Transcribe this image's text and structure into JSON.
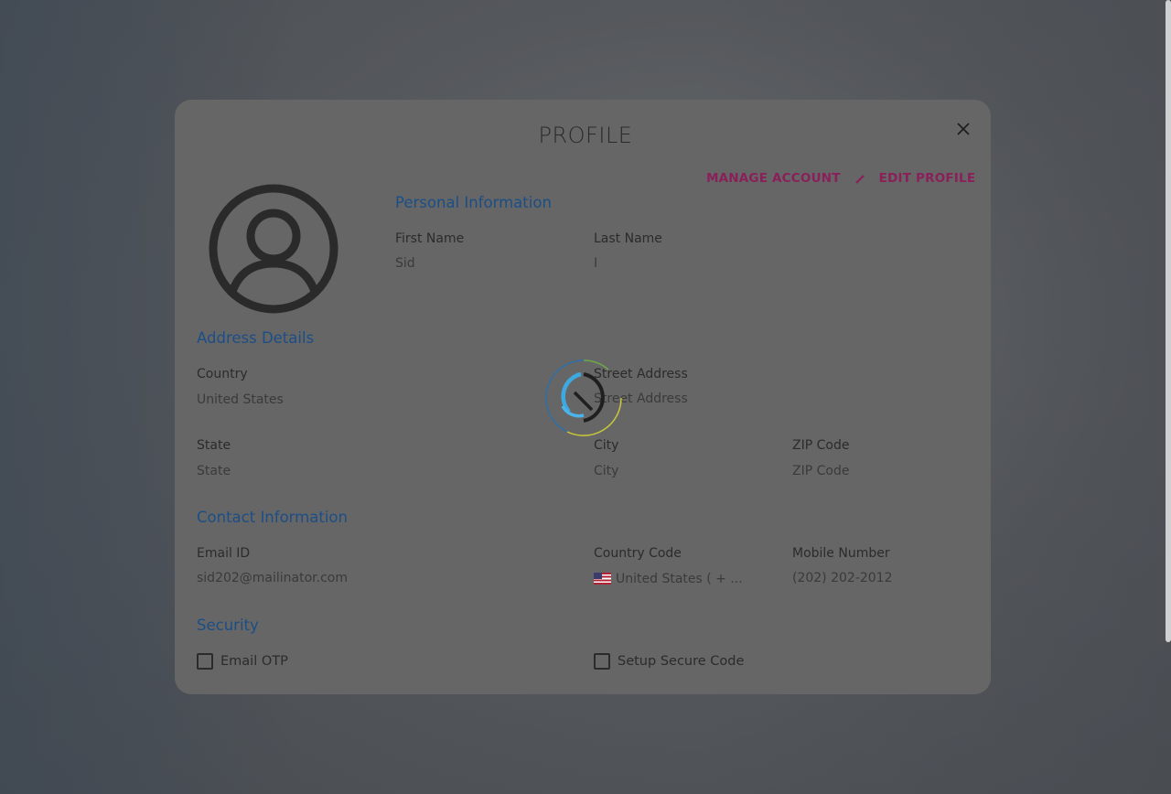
{
  "modal": {
    "title": "PROFILE",
    "manage_account_label": "MANAGE ACCOUNT",
    "edit_profile_label": "EDIT PROFILE"
  },
  "personal": {
    "section_title": "Personal Information",
    "first_name_label": "First Name",
    "first_name_value": "Sid",
    "last_name_label": "Last Name",
    "last_name_value": "I"
  },
  "address": {
    "section_title": "Address Details",
    "country_label": "Country",
    "country_value": "United States",
    "street_label": "Street Address",
    "street_value": "Street Address",
    "state_label": "State",
    "state_value": "State",
    "city_label": "City",
    "city_value": "City",
    "zip_label": "ZIP Code",
    "zip_value": "ZIP Code"
  },
  "contact": {
    "section_title": "Contact Information",
    "email_label": "Email ID",
    "email_value": "sid202@mailinator.com",
    "country_code_label": "Country Code",
    "country_code_value": "United States ( + ...",
    "mobile_label": "Mobile Number",
    "mobile_value": "(202) 202-2012"
  },
  "security": {
    "section_title": "Security",
    "email_otp_label": "Email OTP",
    "secure_code_label": "Setup Secure Code"
  },
  "icons": {
    "close": "close-icon",
    "pencil": "pencil-icon",
    "avatar": "user-avatar-icon",
    "flag": "us-flag-icon",
    "spinner": "loading-spinner-icon"
  },
  "colors": {
    "section_title": "#1c4e86",
    "action_link": "#8a1f5a",
    "modal_bg": "#666666"
  }
}
